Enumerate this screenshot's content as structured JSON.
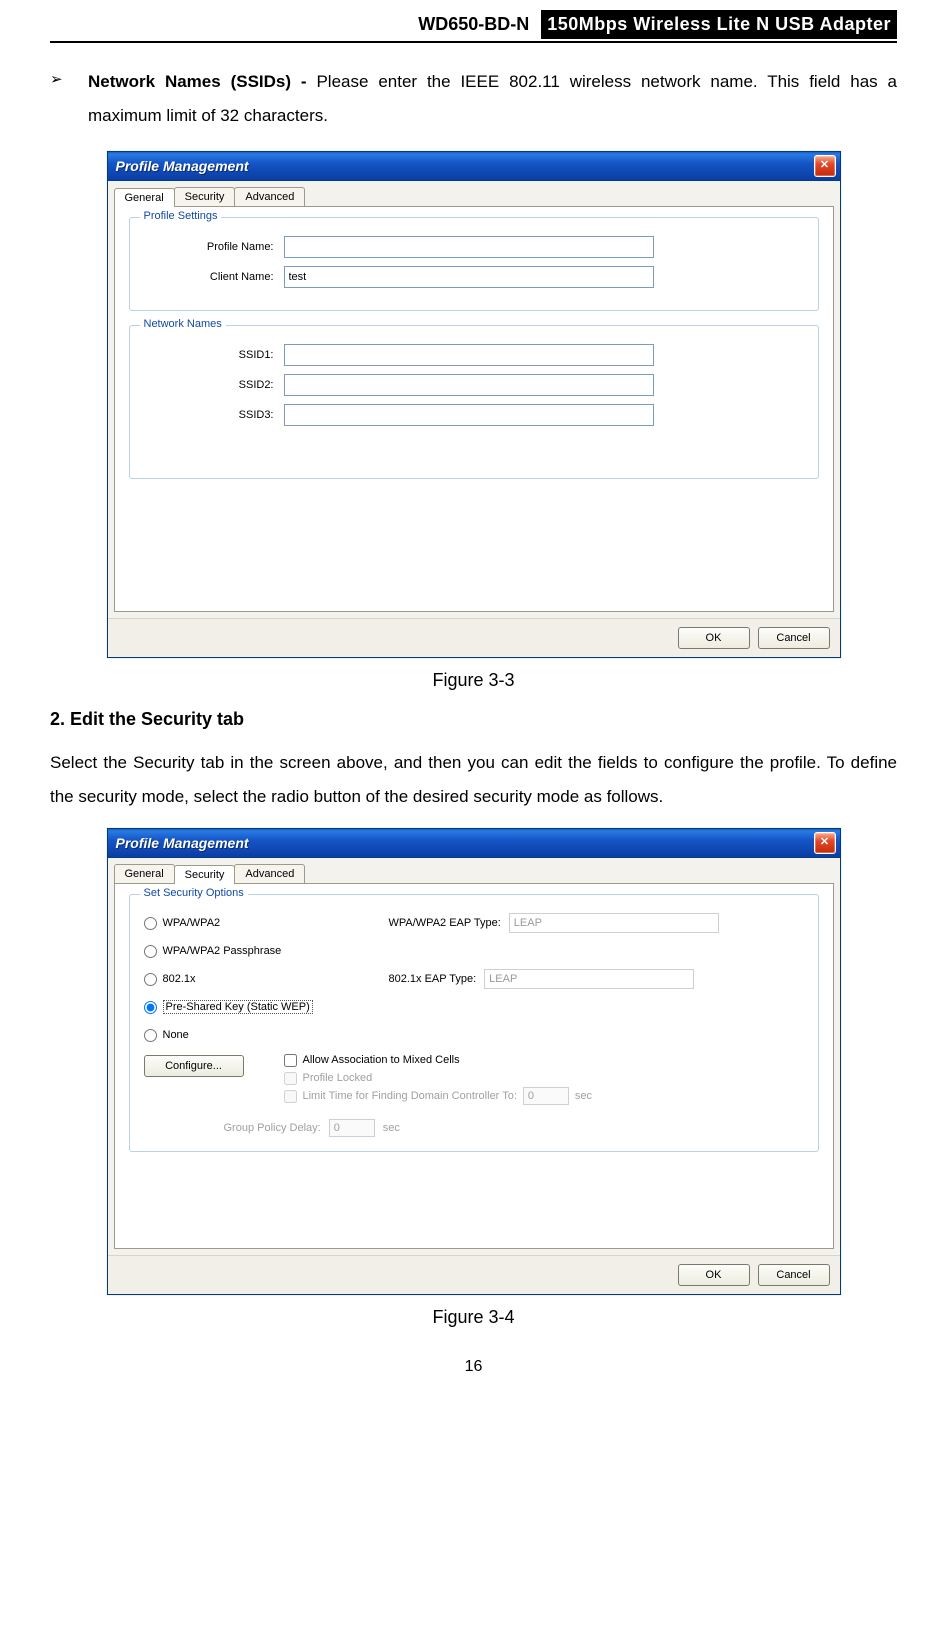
{
  "header": {
    "model": "WD650-BD-N",
    "title": "150Mbps Wireless Lite N USB Adapter"
  },
  "bullet": {
    "label": "Network Names (SSIDs) - ",
    "text": "Please enter the IEEE 802.11 wireless network name. This field has a maximum limit of 32 characters."
  },
  "dialog1": {
    "title": "Profile Management",
    "close_glyph": "✕",
    "tabs": {
      "general": "General",
      "security": "Security",
      "advanced": "Advanced"
    },
    "group_profile": {
      "legend": "Profile Settings",
      "profile_name_label": "Profile Name:",
      "profile_name_value": "",
      "client_name_label": "Client Name:",
      "client_name_value": "test"
    },
    "group_network": {
      "legend": "Network Names",
      "ssid1_label": "SSID1:",
      "ssid1_value": "",
      "ssid2_label": "SSID2:",
      "ssid2_value": "",
      "ssid3_label": "SSID3:",
      "ssid3_value": ""
    },
    "ok": "OK",
    "cancel": "Cancel"
  },
  "fig1_caption": "Figure 3-3",
  "section2": {
    "head": "2.    Edit the Security tab",
    "para": "Select the Security tab in the screen above, and then you can edit the fields to configure the profile. To define the security mode, select the radio button of the desired security mode as follows."
  },
  "dialog2": {
    "title": "Profile Management",
    "close_glyph": "✕",
    "tabs": {
      "general": "General",
      "security": "Security",
      "advanced": "Advanced"
    },
    "group_sec": {
      "legend": "Set Security Options",
      "opt1": "WPA/WPA2",
      "opt2": "WPA/WPA2 Passphrase",
      "opt3": "802.1x",
      "opt4": "Pre-Shared Key (Static WEP)",
      "opt5": "None",
      "eap1_label": "WPA/WPA2 EAP Type:",
      "eap1_value": "LEAP",
      "eap2_label": "802.1x EAP Type:",
      "eap2_value": "LEAP",
      "configure": "Configure...",
      "chk1": "Allow Association to Mixed Cells",
      "chk2": "Profile Locked",
      "chk3": "Limit Time for Finding Domain Controller To:",
      "chk3_val": "0",
      "chk3_unit": "sec",
      "gpd_label": "Group Policy Delay:",
      "gpd_val": "0",
      "gpd_unit": "sec"
    },
    "ok": "OK",
    "cancel": "Cancel"
  },
  "fig2_caption": "Figure 3-4",
  "page_number": "16"
}
